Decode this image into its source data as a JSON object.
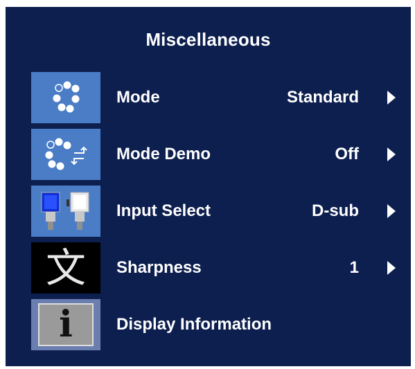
{
  "menu": {
    "title": "Miscellaneous",
    "items": [
      {
        "label": "Mode",
        "value": "Standard",
        "icon": "dots-circle-icon"
      },
      {
        "label": "Mode Demo",
        "value": "Off",
        "icon": "dots-demo-icon"
      },
      {
        "label": "Input Select",
        "value": "D-sub",
        "icon": "connector-plugs-icon"
      },
      {
        "label": "Sharpness",
        "value": "1",
        "icon": "chinese-character-icon"
      },
      {
        "label": "Display Information",
        "value": "",
        "icon": "info-icon"
      }
    ],
    "icon_glyphs": {
      "sharpness": "文",
      "info": "i"
    }
  },
  "colors": {
    "background": "#0d1f4f",
    "icon_blue": "#4a7dc6",
    "text": "#ffffff"
  }
}
